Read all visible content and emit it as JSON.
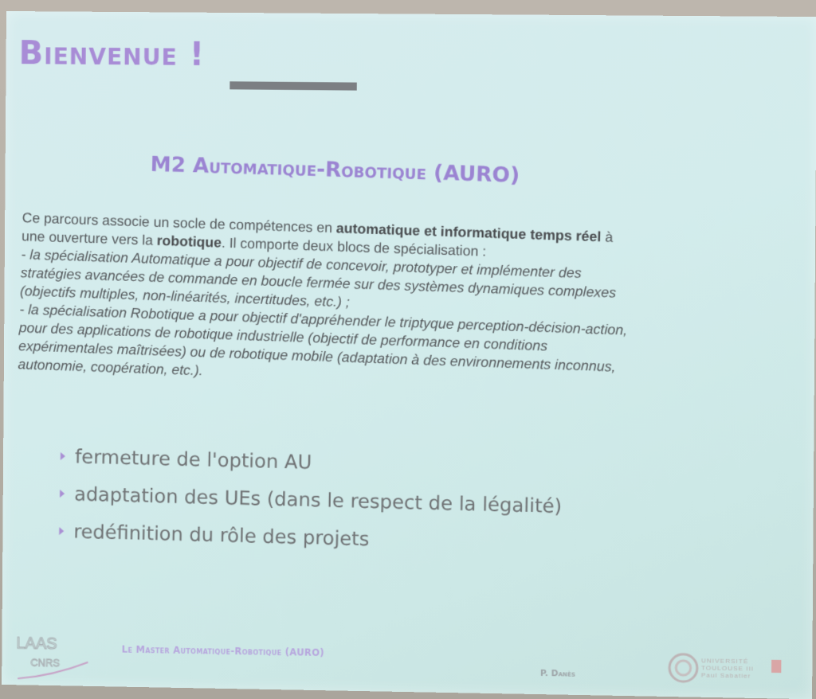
{
  "title": "Bienvenue !",
  "subtitle": "M2 Automatique-Robotique (AURO)",
  "paragraph": {
    "l1a": "Ce parcours associe un socle de compétences en ",
    "l1b": "automatique et informatique temps réel",
    "l1c": " à",
    "l2a": "une ouverture vers la ",
    "l2b": "robotique",
    "l2c": ". Il comporte deux blocs de spécialisation :",
    "l3": "- la spécialisation Automatique a pour objectif de concevoir, prototyper et implémenter des",
    "l4": "stratégies avancées de commande en boucle fermée sur des systèmes dynamiques complexes",
    "l5": "(objectifs multiples, non-linéarités, incertitudes, etc.) ;",
    "l6": "- la spécialisation Robotique a pour objectif d'appréhender le triptyque perception-décision-action,",
    "l7": "pour des applications de robotique industrielle (objectif de performance en conditions",
    "l8": "expérimentales maîtrisées) ou de robotique mobile (adaptation à des environnements inconnus,",
    "l9": "autonomie, coopération, etc.)."
  },
  "bullets": [
    "fermeture de l'option AU",
    "adaptation des UEs (dans le respect de la légalité)",
    "redéfinition du rôle des projets"
  ],
  "footer": {
    "logo_line1": "LAAS",
    "logo_line2": "CNRS",
    "title": "Le Master Automatique-Robotique (AURO)",
    "author": "P. Danès",
    "univ_line1": "UNIVERSITÉ",
    "univ_line2": "TOULOUSE III",
    "univ_line3": "Paul Sabatier"
  },
  "colors": {
    "accent": "#a88cd6",
    "text": "#55595c",
    "background": "#d3ecec"
  }
}
